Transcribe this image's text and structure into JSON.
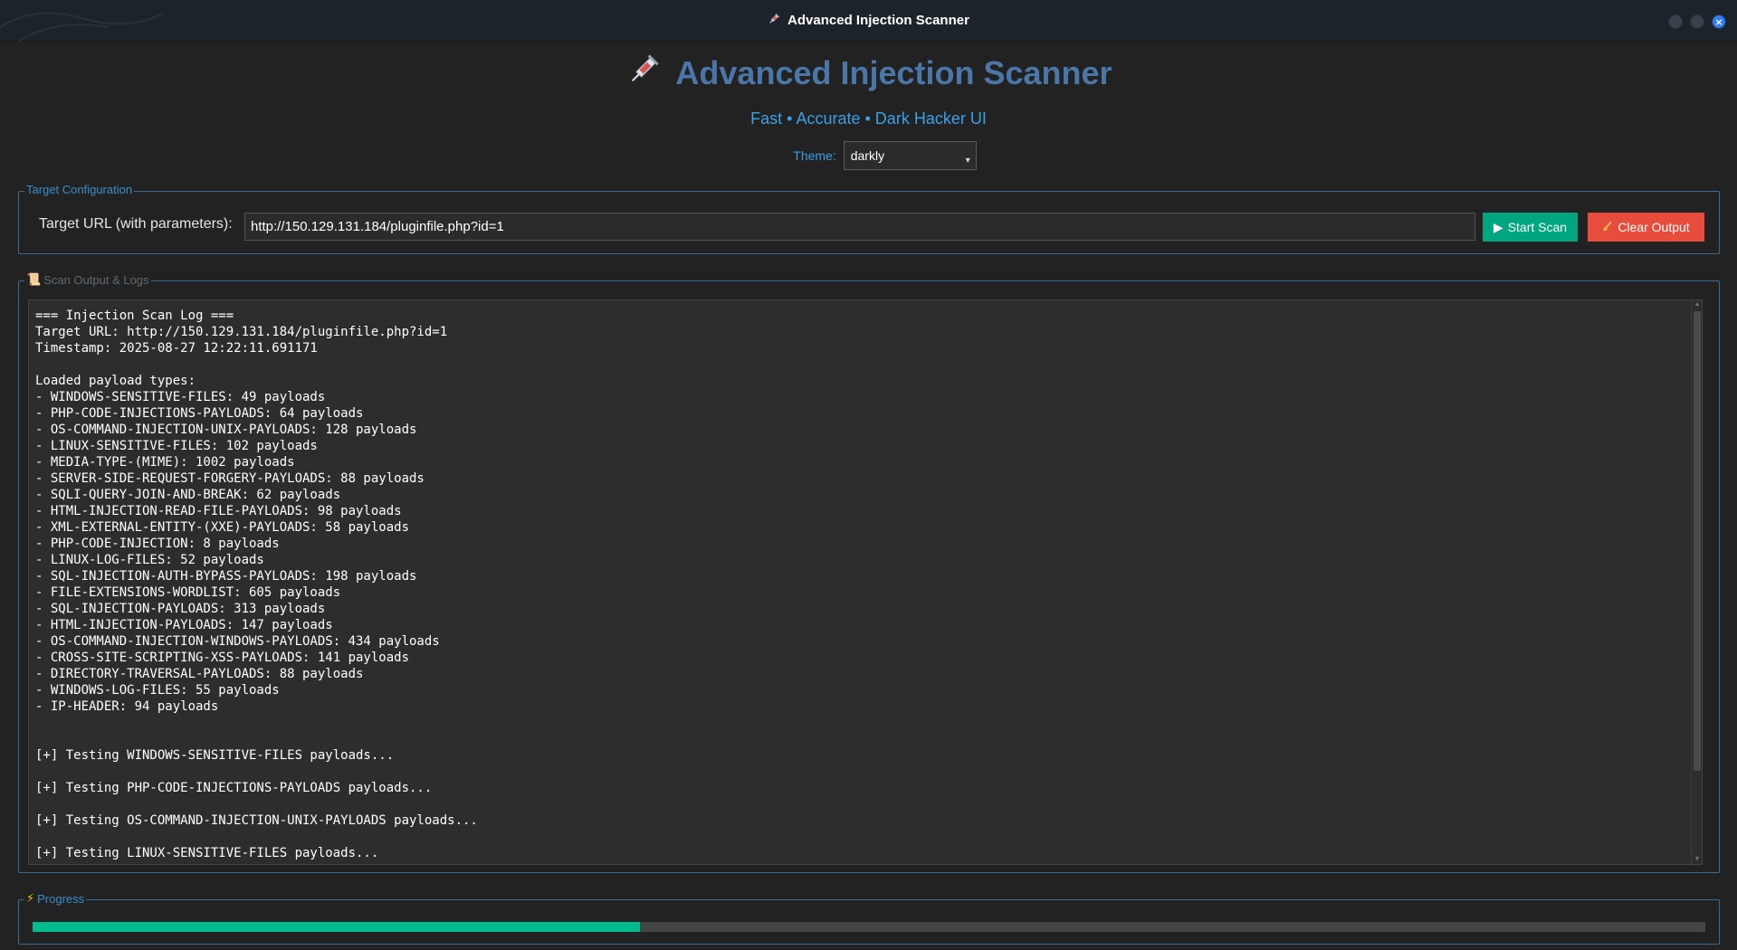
{
  "window": {
    "title": "Advanced Injection Scanner",
    "icon": "syringe-icon"
  },
  "header": {
    "title": "Advanced Injection Scanner",
    "subtitle": "Fast • Accurate • Dark Hacker UI",
    "theme_label": "Theme:",
    "theme_value": "darkly"
  },
  "target": {
    "legend": "Target Configuration",
    "url_label": "Target URL (with parameters):",
    "url_value": "http://150.129.131.184/pluginfile.php?id=1",
    "start_label": "Start Scan",
    "clear_label": "Clear Output"
  },
  "output": {
    "legend": "Scan Output & Logs",
    "log": "=== Injection Scan Log ===\nTarget URL: http://150.129.131.184/pluginfile.php?id=1\nTimestamp: 2025-08-27 12:22:11.691171\n\nLoaded payload types:\n- WINDOWS-SENSITIVE-FILES: 49 payloads\n- PHP-CODE-INJECTIONS-PAYLOADS: 64 payloads\n- OS-COMMAND-INJECTION-UNIX-PAYLOADS: 128 payloads\n- LINUX-SENSITIVE-FILES: 102 payloads\n- MEDIA-TYPE-(MIME): 1002 payloads\n- SERVER-SIDE-REQUEST-FORGERY-PAYLOADS: 88 payloads\n- SQLI-QUERY-JOIN-AND-BREAK: 62 payloads\n- HTML-INJECTION-READ-FILE-PAYLOADS: 98 payloads\n- XML-EXTERNAL-ENTITY-(XXE)-PAYLOADS: 58 payloads\n- PHP-CODE-INJECTION: 8 payloads\n- LINUX-LOG-FILES: 52 payloads\n- SQL-INJECTION-AUTH-BYPASS-PAYLOADS: 198 payloads\n- FILE-EXTENSIONS-WORDLIST: 605 payloads\n- SQL-INJECTION-PAYLOADS: 313 payloads\n- HTML-INJECTION-PAYLOADS: 147 payloads\n- OS-COMMAND-INJECTION-WINDOWS-PAYLOADS: 434 payloads\n- CROSS-SITE-SCRIPTING-XSS-PAYLOADS: 141 payloads\n- DIRECTORY-TRAVERSAL-PAYLOADS: 88 payloads\n- WINDOWS-LOG-FILES: 55 payloads\n- IP-HEADER: 94 payloads\n\n\n[+] Testing WINDOWS-SENSITIVE-FILES payloads...\n\n[+] Testing PHP-CODE-INJECTIONS-PAYLOADS payloads...\n\n[+] Testing OS-COMMAND-INJECTION-UNIX-PAYLOADS payloads...\n\n[+] Testing LINUX-SENSITIVE-FILES payloads..."
  },
  "progress": {
    "legend": "Progress",
    "fraction": 0.363
  },
  "colors": {
    "accent": "#00bc8c",
    "title": "#4a76a8",
    "subtitle": "#3aa0e8",
    "danger": "#e74c3c",
    "success": "#00a67f"
  }
}
